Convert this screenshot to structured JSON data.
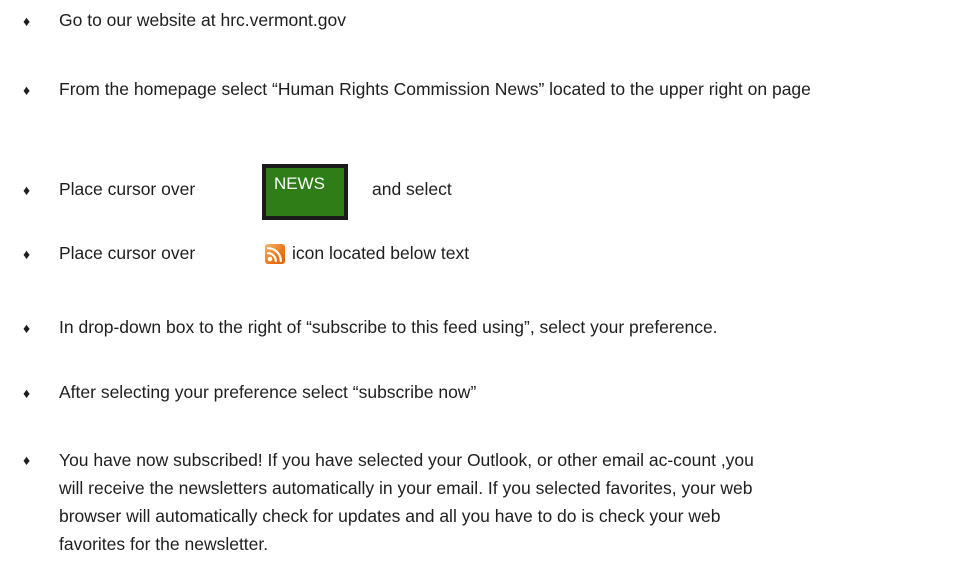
{
  "steps": [
    {
      "bullet": "♦",
      "text": "Go to our website at hrc.vermont.gov"
    },
    {
      "bullet": "♦",
      "text": "From the homepage select “Human Rights Commission News” located to  the upper right on page"
    },
    {
      "bullet": "♦",
      "text_before": "Place cursor over",
      "button_label": "NEWS",
      "text_after": "and select"
    },
    {
      "bullet": "♦",
      "text_before": "Place cursor over",
      "icon": "rss-feed-icon",
      "text_after": "icon located below text"
    },
    {
      "bullet": "♦",
      "text": "In drop-down box to the right of “subscribe to this feed using”, select your preference."
    },
    {
      "bullet": "♦",
      "text": "After selecting your preference  select “subscribe now”"
    },
    {
      "bullet": "♦",
      "text": "You have now subscribed! If you have selected your Outlook, or other email ac-count ,you will receive the newsletters automatically in your email. If you selected favorites, your web browser will automatically check for updates and  all you have to do is check your web favorites for the newsletter."
    }
  ],
  "colors": {
    "news_button_bg": "#2e7d17",
    "news_button_border": "#1a1a1a",
    "rss_orange": "#ec7a1c"
  }
}
